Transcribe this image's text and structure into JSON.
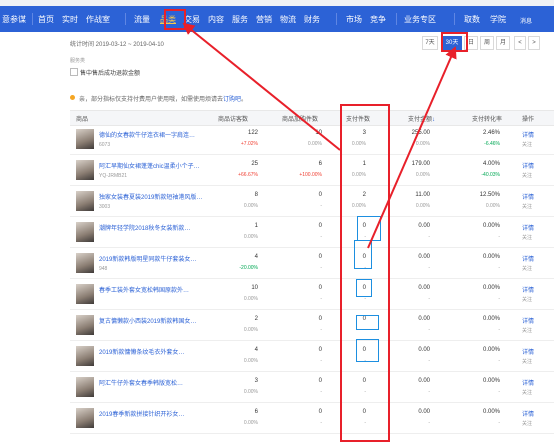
{
  "nav": {
    "logo": "意参谋",
    "items": [
      "首页",
      "实时",
      "作战室",
      "流量",
      "品类",
      "交易",
      "内容",
      "服务",
      "营销",
      "物流",
      "财务",
      "市场",
      "竞争",
      "业务专区",
      "取数",
      "学院"
    ],
    "active_index": 4,
    "right_label": "消息"
  },
  "datebar": {
    "label": "统计时间 2019-03-12 ~ 2019-04-10",
    "periods": [
      "7天",
      "30天",
      "日",
      "周",
      "月"
    ],
    "active_period": "30天",
    "prev": "<",
    "next": ">"
  },
  "filter": {
    "label": "服务类",
    "checkbox_label": "售中售后成功退款金额"
  },
  "notice": {
    "text": "亲，部分指标仅支持付费用户使用哦，如需使用烦请去",
    "link": "订购吧",
    "end": "。"
  },
  "table": {
    "columns": {
      "product": "商品",
      "visitors": "商品访客数",
      "cart": "商品加购件数",
      "paid": "支付件数",
      "amount": "支付金额",
      "conversion": "支付转化率",
      "ops": "操作"
    },
    "rows": [
      {
        "name": "德仙的女春款牛仔连衣裙一字肩连…",
        "id": "6073",
        "visitors": "122",
        "visitors_change": "+7.02%",
        "cart": "10",
        "cart_change": "0.00%",
        "paid": "3",
        "paid_change": "0.00%",
        "amount": "255.00",
        "amount_change": "0.00%",
        "conversion": "2.46%",
        "conversion_change": "-6.46%",
        "op1": "详情",
        "op2": "关注"
      },
      {
        "name": "阿汇早期仙女裙蓬蓬chic温柔小个子…",
        "id": "YQ-JRMB21",
        "visitors": "25",
        "visitors_change": "+66.67%",
        "cart": "6",
        "cart_change": "+100.00%",
        "paid": "1",
        "paid_change": "0.00%",
        "amount": "179.00",
        "amount_change": "0.00%",
        "conversion": "4.00%",
        "conversion_change": "-40.03%",
        "op1": "详情",
        "op2": "关注"
      },
      {
        "name": "独家女装春夏装2019新款短袖港风版…",
        "id": "3003",
        "visitors": "8",
        "visitors_change": "0.00%",
        "cart": "0",
        "cart_change": "-",
        "paid": "2",
        "paid_change": "0.00%",
        "amount": "11.00",
        "amount_change": "0.00%",
        "conversion": "12.50%",
        "conversion_change": "0.00%",
        "op1": "详情",
        "op2": "关注"
      },
      {
        "name": "潮牌年轻学院2018秋冬女装新款…",
        "id": "",
        "visitors": "1",
        "visitors_change": "0.00%",
        "cart": "0",
        "cart_change": "-",
        "paid": "0",
        "paid_change": "-",
        "amount": "0.00",
        "amount_change": "-",
        "conversion": "0.00%",
        "conversion_change": "-",
        "op1": "详情",
        "op2": "关注"
      },
      {
        "name": "2019新款韩版明星同款牛仔套装女…",
        "id": "948",
        "visitors": "4",
        "visitors_change": "-20.00%",
        "cart": "0",
        "cart_change": "-",
        "paid": "0",
        "paid_change": "-",
        "amount": "0.00",
        "amount_change": "-",
        "conversion": "0.00%",
        "conversion_change": "-",
        "op1": "详情",
        "op2": "关注"
      },
      {
        "name": "春季工装外套女宽松韩国原款外…",
        "id": "",
        "visitors": "10",
        "visitors_change": "0.00%",
        "cart": "0",
        "cart_change": "-",
        "paid": "0",
        "paid_change": "-",
        "amount": "0.00",
        "amount_change": "-",
        "conversion": "0.00%",
        "conversion_change": "-",
        "op1": "详情",
        "op2": "关注"
      },
      {
        "name": "复古慵懒款小西装2019新款韩国女…",
        "id": "",
        "visitors": "2",
        "visitors_change": "0.00%",
        "cart": "0",
        "cart_change": "-",
        "paid": "0",
        "paid_change": "-",
        "amount": "0.00",
        "amount_change": "-",
        "conversion": "0.00%",
        "conversion_change": "-",
        "op1": "详情",
        "op2": "关注"
      },
      {
        "name": "2019新款慵懒条纹毛衣外套女…",
        "id": "",
        "visitors": "4",
        "visitors_change": "0.00%",
        "cart": "0",
        "cart_change": "-",
        "paid": "0",
        "paid_change": "-",
        "amount": "0.00",
        "amount_change": "-",
        "conversion": "0.00%",
        "conversion_change": "-",
        "op1": "详情",
        "op2": "关注"
      },
      {
        "name": "阿汇牛仔外套女春季韩版宽松…",
        "id": "",
        "visitors": "3",
        "visitors_change": "0.00%",
        "cart": "0",
        "cart_change": "-",
        "paid": "0",
        "paid_change": "-",
        "amount": "0.00",
        "amount_change": "-",
        "conversion": "0.00%",
        "conversion_change": "-",
        "op1": "详情",
        "op2": "关注"
      },
      {
        "name": "2019春季新款拼接针织开衫女…",
        "id": "",
        "visitors": "6",
        "visitors_change": "0.00%",
        "cart": "0",
        "cart_change": "-",
        "paid": "0",
        "paid_change": "-",
        "amount": "0.00",
        "amount_change": "-",
        "conversion": "0.00%",
        "conversion_change": "-",
        "op1": "详情",
        "op2": "关注"
      }
    ]
  },
  "colors": {
    "nav_bg": "#2c62d6",
    "nav_active": "#f7c94a",
    "annotation_red": "#e8202a",
    "annotation_blue": "#1d8fe0"
  }
}
